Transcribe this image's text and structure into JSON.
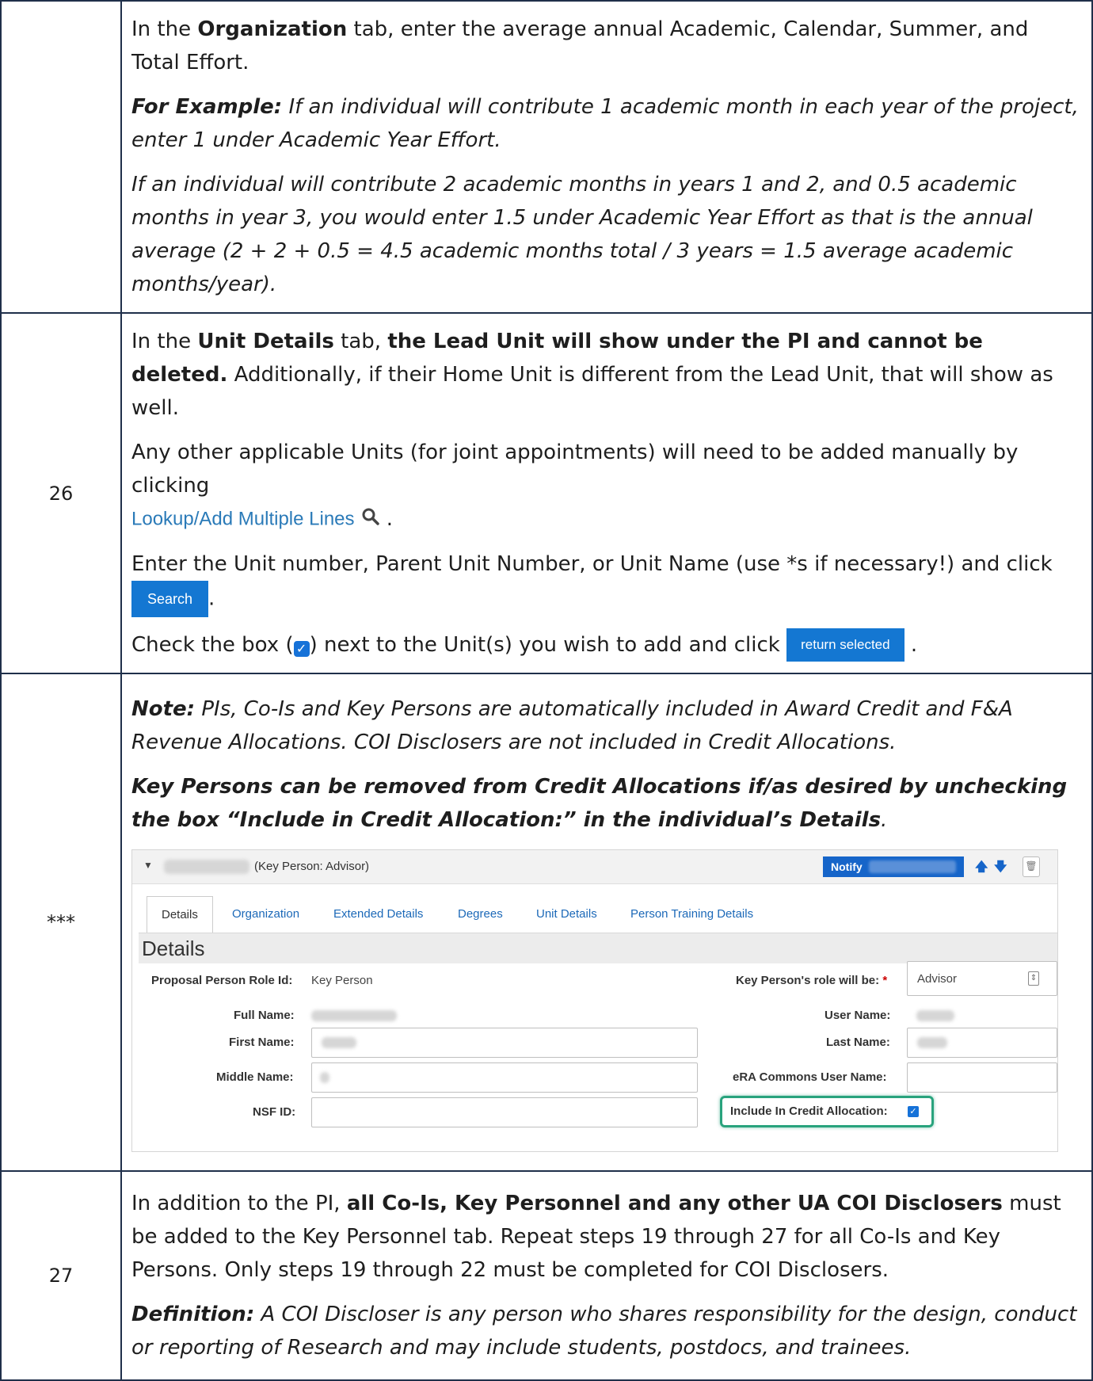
{
  "rows": [
    {
      "number": "",
      "p1_pre": "In the ",
      "p1_bold": "Organization",
      "p1_post": " tab, enter the average annual Academic, Calendar, Summer, and Total Effort.",
      "p2_bold": "For Example:",
      "p2_rest": " If an individual will contribute 1 academic month in each year of the project, enter 1 under Academic Year Effort.",
      "p3": "If an individual will contribute 2 academic months in years 1 and 2, and 0.5 academic months in year 3, you would enter 1.5 under Academic Year Effort as that is the annual average (2 + 2 + 0.5 = 4.5 academic months total / 3 years = 1.5 average academic months/year)."
    },
    {
      "number": "26",
      "p1_pre": "In the ",
      "p1_bold": "Unit Details",
      "p1_mid": " tab, ",
      "p1_bold2": "the Lead Unit will show under the PI and cannot be deleted.",
      "p1_post": " Additionally, if their Home Unit is different from the Lead Unit, that will show as well.",
      "p2": "Any other applicable Units (for joint appointments) will need to be added manually by clicking",
      "lookup_link": "Lookup/Add Multiple Lines",
      "p2_end": ".",
      "p3": "Enter the Unit number, Parent Unit Number, or Unit Name (use *s if necessary!) and click",
      "search_button": "Search",
      "p3_end": ".",
      "p4_pre": "Check the box (",
      "p4_post": ") next to the Unit(s) you wish to add and click",
      "return_button": "return selected",
      "p4_end": "."
    },
    {
      "number": "***",
      "note_bold": "Note:",
      "note_rest": " PIs, Co-Is and Key Persons are automatically included in Award Credit and F&A Revenue Allocations. COI Disclosers are not included in Credit Allocations.",
      "key_bold": "Key Persons can be removed from Credit Allocations if/as desired by unchecking the box “Include in Credit Allocation:” in the individual’s Details",
      "key_end": "."
    },
    {
      "number": "27",
      "p1_pre": "In addition to the PI, ",
      "p1_bold": "all Co-Is, Key Personnel and any other UA COI Disclosers",
      "p1_post": " must be added to the Key Personnel tab. Repeat steps 19 through 27 for all Co-Is and Key Persons. Only steps 19 through 22 must be completed for COI Disclosers.",
      "def_bold": "Definition:",
      "def_rest": " A COI Discloser is any person who shares responsibility for the design, conduct or reporting of Research and may include students, postdocs, and trainees."
    }
  ],
  "screenshot": {
    "role_label": "(Key Person: Advisor)",
    "notify_label": "Notify",
    "tabs": [
      "Details",
      "Organization",
      "Extended Details",
      "Degrees",
      "Unit Details",
      "Person Training Details"
    ],
    "section_title": "Details",
    "fields": {
      "role_id_label": "Proposal Person Role Id:",
      "role_id_value": "Key Person",
      "role_will_be_label": "Key Person's role will be:",
      "required_mark": "*",
      "role_will_be_value": "Advisor",
      "full_name_label": "Full Name:",
      "user_name_label": "User Name:",
      "first_name_label": "First Name:",
      "last_name_label": "Last Name:",
      "middle_name_label": "Middle Name:",
      "era_label": "eRA Commons User Name:",
      "nsf_label": "NSF ID:",
      "credit_label": "Include In Credit Allocation:"
    }
  }
}
